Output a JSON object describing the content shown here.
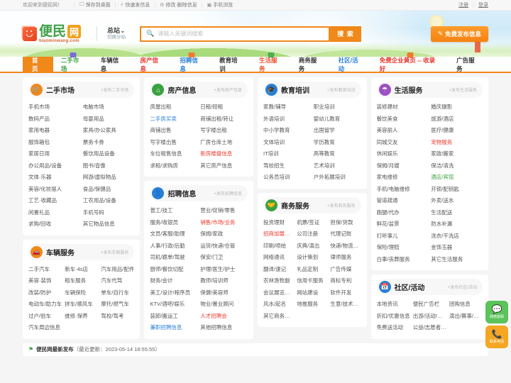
{
  "topbar": {
    "welcome": "欢迎来到便民网！",
    "items": [
      {
        "icon": "monitor-icon",
        "glyph": "🖵",
        "label": "保存到桌面"
      },
      {
        "icon": "lightning-icon",
        "glyph": "⚡",
        "label": "快速发信息"
      },
      {
        "icon": "gear-icon",
        "glyph": "⚙",
        "label": "修改·删除信息"
      },
      {
        "icon": "qrcode-icon",
        "glyph": "▣",
        "label": "手机浏览"
      }
    ],
    "register": "注册",
    "login": "登录",
    "separator": "|"
  },
  "header": {
    "logo_cn": "便民",
    "logo_box": "网",
    "logo_domain": "bianminwang.com",
    "station_name": "总站",
    "station_caret": "⌄",
    "station_sub": "切换分站",
    "search_placeholder": "请输入关键词搜索",
    "search_value": "",
    "search_button": "搜 索",
    "search_icon": "🔍",
    "publish_icon": "✎",
    "publish_label": "免费发布信息"
  },
  "nav": [
    {
      "label": "首页",
      "style": "home",
      "bubble": ""
    },
    {
      "label": "二手市场",
      "style": "c-green",
      "bubble": "#7b6bd6"
    },
    {
      "label": "车辆信息",
      "style": "",
      "bubble": ""
    },
    {
      "label": "房产信息",
      "style": "c-red",
      "bubble": ""
    },
    {
      "label": "招聘信息",
      "style": "c-blue",
      "bubble": "#f07a2a"
    },
    {
      "label": "教育培训",
      "style": "",
      "bubble": ""
    },
    {
      "label": "生活服务",
      "style": "c-orange",
      "bubble": "#4caf50"
    },
    {
      "label": "商务服务",
      "style": "",
      "bubble": ""
    },
    {
      "label": "社区/活动",
      "style": "c-blue",
      "bubble": ""
    },
    {
      "label": "免费企业黄页 -- 收录好",
      "style": "c-red",
      "bubble": "#f07a2a"
    },
    {
      "label": "广告服务",
      "style": "",
      "bubble": ""
    }
  ],
  "cards": {
    "secondhand": {
      "title": "二手市场",
      "icon": "cart-icon",
      "glyph": "🛒",
      "color": "#f0881a",
      "more": "+发布二手市场",
      "columns": 2,
      "links": [
        {
          "label": "手机市场"
        },
        {
          "label": "电脑市场"
        },
        {
          "label": "数码产品"
        },
        {
          "label": "母婴用品"
        },
        {
          "label": "家用电器"
        },
        {
          "label": "家具/办公家具"
        },
        {
          "label": "服饰箱包"
        },
        {
          "label": "票务卡券"
        },
        {
          "label": "家居日用"
        },
        {
          "label": "餐饮用品设备"
        },
        {
          "label": "办公用品/设备"
        },
        {
          "label": "图书/音像"
        },
        {
          "label": "文体·乐器"
        },
        {
          "label": "网游/虚拟物品"
        },
        {
          "label": "美容/化妆丽人"
        },
        {
          "label": "食品/保健品"
        },
        {
          "label": "工艺·收藏品"
        },
        {
          "label": "工农用品/设备"
        },
        {
          "label": "闲置礼品"
        },
        {
          "label": "手机号码"
        },
        {
          "label": "求购/回收"
        },
        {
          "label": "其它物品信息"
        }
      ]
    },
    "vehicle": {
      "title": "车辆服务",
      "icon": "car-icon",
      "glyph": "🚗",
      "color": "#f0881a",
      "more": "+发布车辆服务",
      "columns": 3,
      "links": [
        {
          "label": "二手汽车"
        },
        {
          "label": "新车·4s店"
        },
        {
          "label": "汽车用品/配件"
        },
        {
          "label": "美容·装饰"
        },
        {
          "label": "租车服务"
        },
        {
          "label": "汽车代驾"
        },
        {
          "label": "改装/防护"
        },
        {
          "label": "车辆保险"
        },
        {
          "label": "单车/自行车"
        },
        {
          "label": "电动车/助力车"
        },
        {
          "label": "拼车/顺风车"
        },
        {
          "label": "摩托/燃气车"
        },
        {
          "label": "过户/验车"
        },
        {
          "label": "维修·保养"
        },
        {
          "label": "驾校/驾考"
        },
        {
          "label": "汽车周边信息"
        }
      ]
    },
    "house": {
      "title": "房产信息",
      "icon": "house-icon",
      "glyph": "⌂",
      "color": "#3aa13f",
      "more": "+发布房产信息",
      "columns": 2,
      "links": [
        {
          "label": "房屋出租"
        },
        {
          "label": "日租/短租"
        },
        {
          "label": "二手房买卖",
          "color": "blue"
        },
        {
          "label": "商铺出租/转让"
        },
        {
          "label": "商铺出售"
        },
        {
          "label": "写字楼出租"
        },
        {
          "label": "写字楼出售"
        },
        {
          "label": "厂房仓库土地"
        },
        {
          "label": "车位租售信息"
        },
        {
          "label": "新房楼盘信息",
          "color": "red"
        },
        {
          "label": "求租/求购房"
        },
        {
          "label": "其它房产信息"
        }
      ]
    },
    "job": {
      "title": "招聘信息",
      "icon": "person-icon",
      "glyph": "👤",
      "color": "#2a7fd4",
      "more": "+发布招聘信息",
      "columns": 2,
      "links": [
        {
          "label": "普工/技工"
        },
        {
          "label": "营业/促销/零售"
        },
        {
          "label": "服务/收银员"
        },
        {
          "label": "销售/市场/业务",
          "color": "red"
        },
        {
          "label": "文员/客服/助理"
        },
        {
          "label": "保姆/家政"
        },
        {
          "label": "人事/行政/后勤"
        },
        {
          "label": "运货/快递/仓管"
        },
        {
          "label": "司机/跟单/驾驶"
        },
        {
          "label": "保安/门卫"
        },
        {
          "label": "厨师/餐饮切配"
        },
        {
          "label": "护理/医生/护士"
        },
        {
          "label": "财务/会计"
        },
        {
          "label": "教师/培训师"
        },
        {
          "label": "美工/设计/程序员"
        },
        {
          "label": "保健/美容师"
        },
        {
          "label": "KTV/酒吧/娱乐"
        },
        {
          "label": "物业/置业顾问"
        },
        {
          "label": "装卸/搬运工"
        },
        {
          "label": "人才招聘会",
          "color": "red"
        },
        {
          "label": "兼职招聘信息",
          "color": "blue"
        },
        {
          "label": "其他招聘信息"
        }
      ]
    },
    "education": {
      "title": "教育培训",
      "icon": "graduation-cap-icon",
      "glyph": "🎓",
      "color": "#2a7fd4",
      "more": "+发布教育培训",
      "columns": 2,
      "links": [
        {
          "label": "家教/辅导"
        },
        {
          "label": "职业培训"
        },
        {
          "label": "外语培训"
        },
        {
          "label": "婴幼儿教育"
        },
        {
          "label": "中小学教育"
        },
        {
          "label": "出国留学"
        },
        {
          "label": "文体培训"
        },
        {
          "label": "学历教育"
        },
        {
          "label": "IT培训"
        },
        {
          "label": "高等教育"
        },
        {
          "label": "驾校招生"
        },
        {
          "label": "艺术培训"
        },
        {
          "label": "公务员培训"
        },
        {
          "label": "户外拓展培训"
        }
      ]
    },
    "business": {
      "title": "商务服务",
      "icon": "handshake-icon",
      "glyph": "🤝",
      "color": "#3aa13f",
      "more": "+发布商务服务",
      "columns": 3,
      "links": [
        {
          "label": "投资理财"
        },
        {
          "label": "机票/签证"
        },
        {
          "label": "担保/贷款"
        },
        {
          "label": "招商加盟合作",
          "color": "red"
        },
        {
          "label": "公司注册"
        },
        {
          "label": "代理记账"
        },
        {
          "label": "印刷/喷绘"
        },
        {
          "label": "庆典/演出"
        },
        {
          "label": "快递/物流货运"
        },
        {
          "label": "网络通讯"
        },
        {
          "label": "设计策划"
        },
        {
          "label": "律师服务"
        },
        {
          "label": "翻译/速记"
        },
        {
          "label": "礼品定制"
        },
        {
          "label": "广告传媒"
        },
        {
          "label": "农林渔牧副"
        },
        {
          "label": "信用卡服务"
        },
        {
          "label": "商标专利"
        },
        {
          "label": "会议展览会展"
        },
        {
          "label": "网站建设"
        },
        {
          "label": "软件开发"
        },
        {
          "label": "风水/起名"
        },
        {
          "label": "地推服务"
        },
        {
          "label": "生意/技术转让"
        },
        {
          "label": "其它商务服务"
        }
      ]
    },
    "life": {
      "title": "生活服务",
      "icon": "umbrella-icon",
      "glyph": "☂",
      "color": "#9b51c4",
      "more": "+发布生活服务",
      "columns": 2,
      "links": [
        {
          "label": "装修建材"
        },
        {
          "label": "婚庆摄影"
        },
        {
          "label": "餐饮美食"
        },
        {
          "label": "旅游/酒店"
        },
        {
          "label": "美容丽人"
        },
        {
          "label": "医疗/健康"
        },
        {
          "label": "同城交友"
        },
        {
          "label": "宠物服务",
          "color": "red"
        },
        {
          "label": "休闲娱乐"
        },
        {
          "label": "家政/搬家"
        },
        {
          "label": "保姆/月嫂"
        },
        {
          "label": "保洁/清洗"
        },
        {
          "label": "家电维修"
        },
        {
          "label": "酒店/宾馆",
          "color": "green"
        },
        {
          "label": "手机/电脑维修"
        },
        {
          "label": "开锁/配钥匙"
        },
        {
          "label": "管道疏通"
        },
        {
          "label": "外卖/送水"
        },
        {
          "label": "跑腿/代办"
        },
        {
          "label": "生活配送"
        },
        {
          "label": "鲜花/盆景"
        },
        {
          "label": "防水补漏"
        },
        {
          "label": "打听事儿"
        },
        {
          "label": "洗衣/干洗店"
        },
        {
          "label": "保险/理赔"
        },
        {
          "label": "金饰玉器"
        },
        {
          "label": "白事/丧葬服务"
        },
        {
          "label": "其它生活服务"
        }
      ]
    },
    "community": {
      "title": "社区/活动",
      "icon": "calendar-icon",
      "glyph": "📅",
      "color": "#2a7fd4",
      "more": "+发布社区/活动",
      "columns": 3,
      "links": [
        {
          "label": "本地资讯"
        },
        {
          "label": "便民广告栏"
        },
        {
          "label": "团购信息"
        },
        {
          "label": "折扣/优惠信息"
        },
        {
          "label": "出游/活动/聚会"
        },
        {
          "label": "演出/赛事/展览"
        },
        {
          "label": "免费送活动"
        },
        {
          "label": "公益/志愿者活动"
        }
      ]
    }
  },
  "footer": {
    "flag_icon": "flag-icon",
    "title": "便民网最新发布",
    "update": "（最近更新：2023-05-14 18:55:55）"
  },
  "side_buttons": [
    {
      "icon": "chat-icon",
      "glyph": "💬",
      "label": "网络客服",
      "style": "sb-green"
    },
    {
      "icon": "phone-icon",
      "glyph": "📞",
      "label": "联系电话",
      "style": "sb-orange"
    }
  ]
}
